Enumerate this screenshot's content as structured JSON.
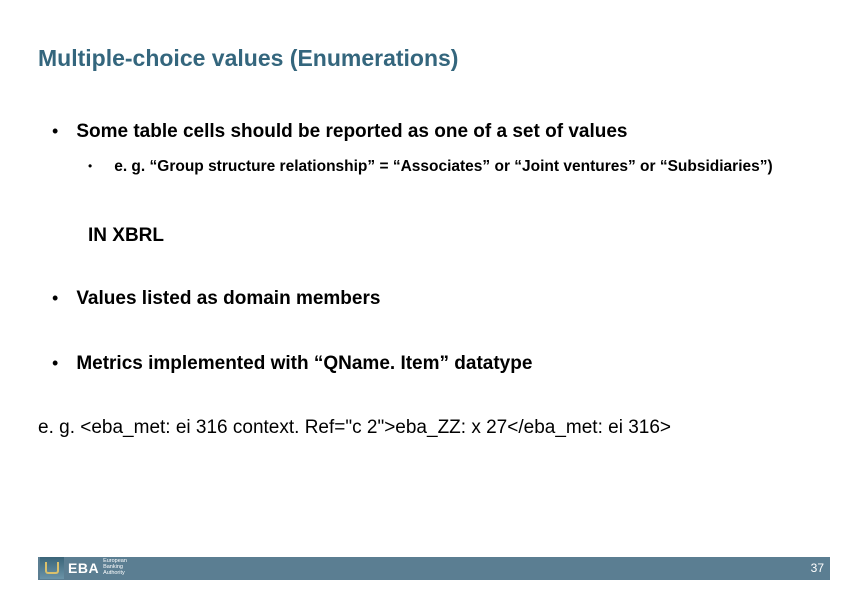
{
  "title": "Multiple-choice values (Enumerations)",
  "bullets": {
    "main": {
      "text": "Some table cells should be reported as one of a set of values",
      "sub": "e. g. “Group structure relationship” = “Associates” or “Joint ventures” or “Subsidiaries”)"
    },
    "section": "IN XBRL",
    "item1": "Values listed as domain members",
    "item2": "Metrics implemented with “QName. Item” datatype"
  },
  "example": "e. g. <eba_met: ei 316 context. Ref=\"c 2\">eba_ZZ: x 27</eba_met: ei 316>",
  "footer": {
    "logo_main": "EBA",
    "logo_sub1": "European",
    "logo_sub2": "Banking",
    "logo_sub3": "Authority",
    "page": "37"
  }
}
